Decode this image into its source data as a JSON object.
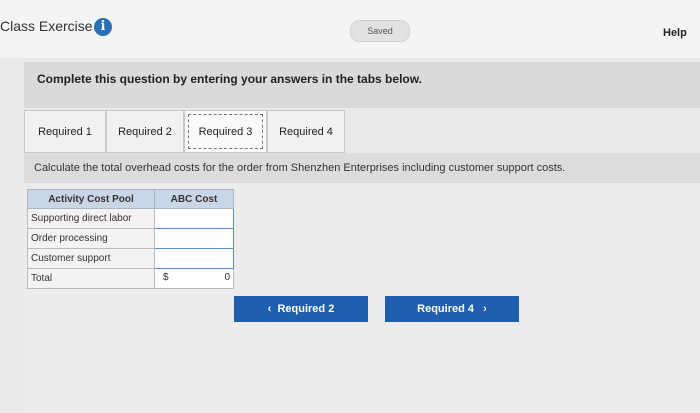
{
  "header": {
    "title": "Class Exercise",
    "info_icon": "i",
    "saved_label": "Saved",
    "help_label": "Help"
  },
  "instruction": "Complete this question by entering your answers in the tabs below.",
  "tabs": [
    {
      "label": "Required 1",
      "active": false
    },
    {
      "label": "Required 2",
      "active": false
    },
    {
      "label": "Required 3",
      "active": true
    },
    {
      "label": "Required 4",
      "active": false
    }
  ],
  "prompt": "Calculate the total overhead costs for the order from Shenzhen Enterprises including customer support costs.",
  "table": {
    "headers": [
      "Activity Cost Pool",
      "ABC Cost"
    ],
    "rows": [
      {
        "pool": "Supporting direct labor",
        "value": ""
      },
      {
        "pool": "Order processing",
        "value": ""
      },
      {
        "pool": "Customer support",
        "value": ""
      }
    ],
    "total": {
      "label": "Total",
      "currency": "$",
      "value": "0"
    }
  },
  "nav": {
    "prev_label": "Required 2",
    "next_label": "Required 4",
    "prev_icon": "chevron-left-icon",
    "next_icon": "chevron-right-icon"
  },
  "colors": {
    "accent": "#1f5fad",
    "table_header": "#c9d6e6",
    "info_icon": "#2a6fb2"
  }
}
